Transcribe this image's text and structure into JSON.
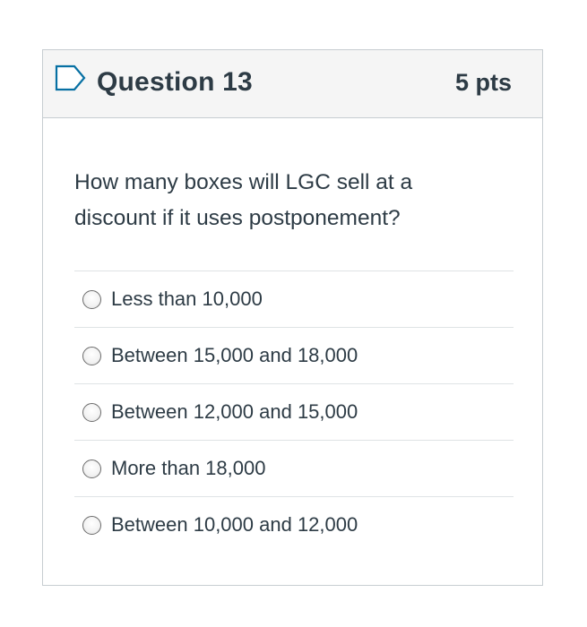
{
  "question": {
    "title": "Question 13",
    "points": "5 pts",
    "flag_icon": "bookmark-flag-outline-icon",
    "text": "How many boxes will LGC sell at a discount if it uses postponement?",
    "answers": [
      {
        "label": "Less than 10,000",
        "selected": false
      },
      {
        "label": "Between 15,000 and 18,000",
        "selected": false
      },
      {
        "label": "Between 12,000 and 15,000",
        "selected": false
      },
      {
        "label": "More than 18,000",
        "selected": false
      },
      {
        "label": "Between 10,000 and 12,000",
        "selected": false
      }
    ]
  },
  "colors": {
    "text": "#2d3b45",
    "header_bg": "#f5f5f5",
    "border": "#c7cdd1",
    "divider": "#dfe3e5",
    "flag": "#0770a3"
  }
}
